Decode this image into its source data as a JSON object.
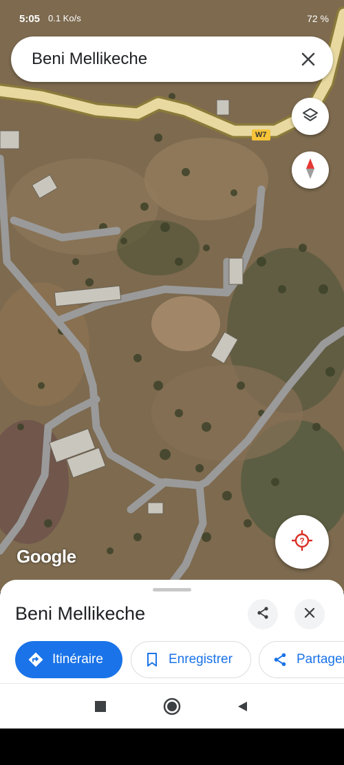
{
  "status_bar": {
    "time": "5:05",
    "speed": "0.1 Ko/s",
    "battery": "72 %"
  },
  "search": {
    "query": "Beni Mellikeche"
  },
  "map": {
    "road_label": "W7",
    "attribution": "Google",
    "colors": {
      "terrain": "#7d6a4f",
      "road": "#9a9a9a",
      "highway": "#e8d9a0"
    }
  },
  "sheet": {
    "place_name": "Beni Mellikeche",
    "actions": [
      {
        "label": "Itinéraire"
      },
      {
        "label": "Enregistrer"
      },
      {
        "label": "Partager"
      }
    ]
  },
  "colors": {
    "accent": "#1a73e8",
    "compass_red": "#e53935",
    "locate_red": "#d93025"
  },
  "icons": {
    "layers": "layers-icon",
    "compass": "compass-icon",
    "locate": "my-location-icon",
    "share": "share-icon",
    "close": "close-icon",
    "directions": "directions-icon",
    "bookmark": "bookmark-icon"
  }
}
